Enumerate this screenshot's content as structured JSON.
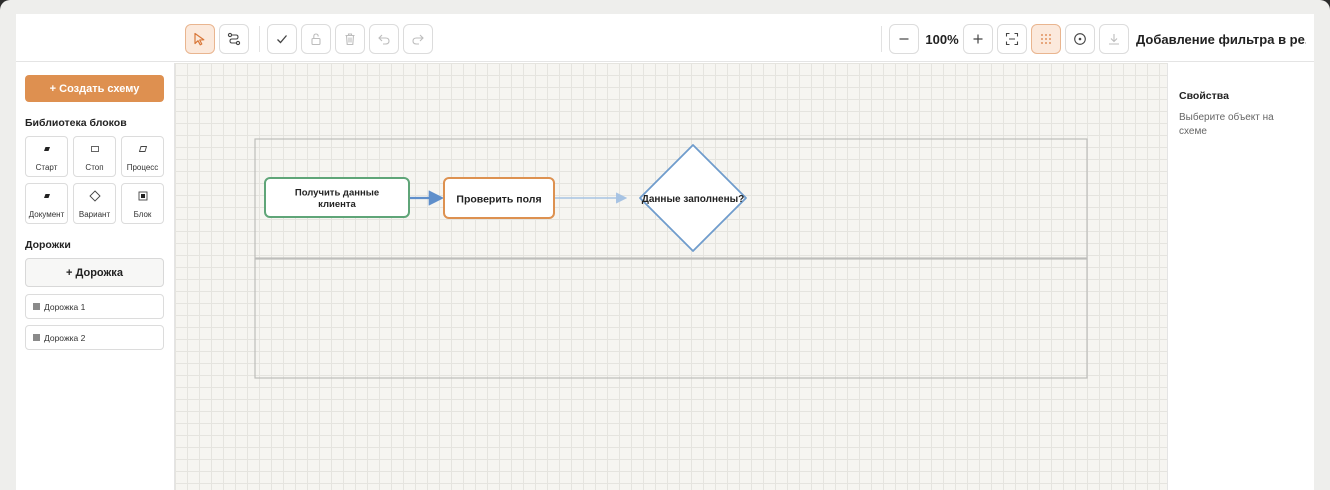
{
  "toolbar": {
    "zoom": "100%",
    "document_title": "Добавление фильтра в ре...",
    "buttons": {
      "select": "cursor-icon",
      "connect": "connector-icon",
      "check": "check-icon",
      "lock": "lock-icon",
      "delete": "trash-icon",
      "undo": "undo-icon",
      "redo": "redo-icon",
      "zoom_out": "minus-icon",
      "zoom_in": "plus-icon",
      "fit": "fit-screen-icon",
      "grid": "grid-dots-icon",
      "center": "target-icon",
      "export": "download-icon"
    }
  },
  "sidebar": {
    "create_button": "+ Создать схему",
    "library_title": "Библиотека блоков",
    "blocks": [
      {
        "label": "Старт",
        "icon": "start-shape-icon"
      },
      {
        "label": "Стоп",
        "icon": "stop-shape-icon"
      },
      {
        "label": "Процесс",
        "icon": "process-shape-icon"
      },
      {
        "label": "Документ",
        "icon": "document-shape-icon"
      },
      {
        "label": "Вариант",
        "icon": "diamond-shape-icon"
      },
      {
        "label": "Блок",
        "icon": "block-shape-icon"
      }
    ],
    "lanes_title": "Дорожки",
    "add_lane_button": "+ Дорожка",
    "lanes": [
      "Дорожка 1",
      "Дорожка 2"
    ]
  },
  "canvas": {
    "nodes": [
      {
        "id": "n1",
        "text_lines": [
          "Получить данные",
          "клиента"
        ],
        "kind": "start",
        "border_color": "#5fa578"
      },
      {
        "id": "n2",
        "text_lines": [
          "Проверить поля"
        ],
        "kind": "process",
        "border_color": "#dd9150",
        "selected": true
      },
      {
        "id": "n3",
        "text_lines": [
          "Данные заполнены?"
        ],
        "kind": "decision",
        "border_color": "#6f9ccc"
      }
    ],
    "edges": [
      {
        "from": "n1",
        "to": "n2",
        "color": "#5f8fcb"
      },
      {
        "from": "n2",
        "to": "n3",
        "color": "#a7c3e3"
      }
    ]
  },
  "properties": {
    "title": "Свойства",
    "hint": "Выберите объект на схеме"
  },
  "colors": {
    "accent": "#de9050",
    "accent_light": "#fbe9dc",
    "canvas_bg": "#f6f5f1"
  }
}
